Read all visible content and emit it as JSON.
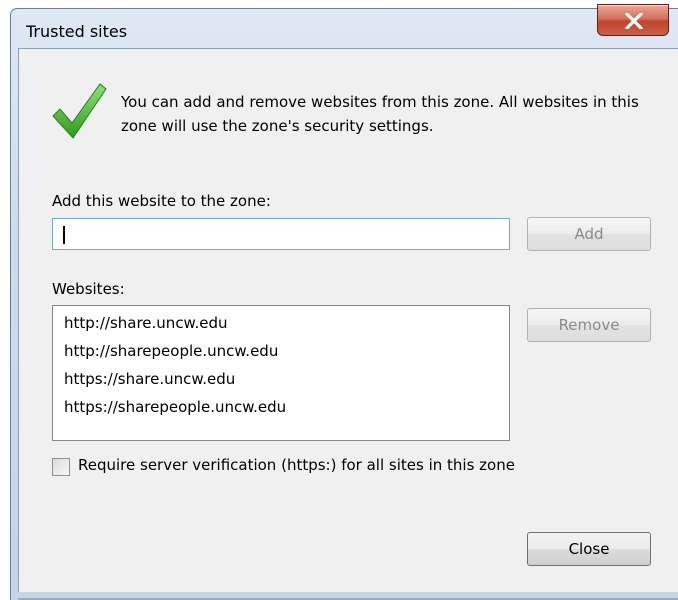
{
  "window": {
    "title": "Trusted sites",
    "close_icon": "close-x-icon"
  },
  "intro": {
    "icon": "checkmark-icon",
    "text": "You can add and remove websites from this zone. All websites in this zone will use the zone's security settings."
  },
  "add_section": {
    "label": "Add this website to the zone:",
    "input_value": "",
    "add_button": "Add"
  },
  "websites": {
    "label": "Websites:",
    "items": [
      "http://share.uncw.edu",
      "http://sharepeople.uncw.edu",
      "https://share.uncw.edu",
      "https://sharepeople.uncw.edu"
    ],
    "remove_button": "Remove"
  },
  "verification": {
    "checked": false,
    "label": "Require server verification (https:) for all sites in this zone"
  },
  "footer": {
    "close_button": "Close"
  }
}
